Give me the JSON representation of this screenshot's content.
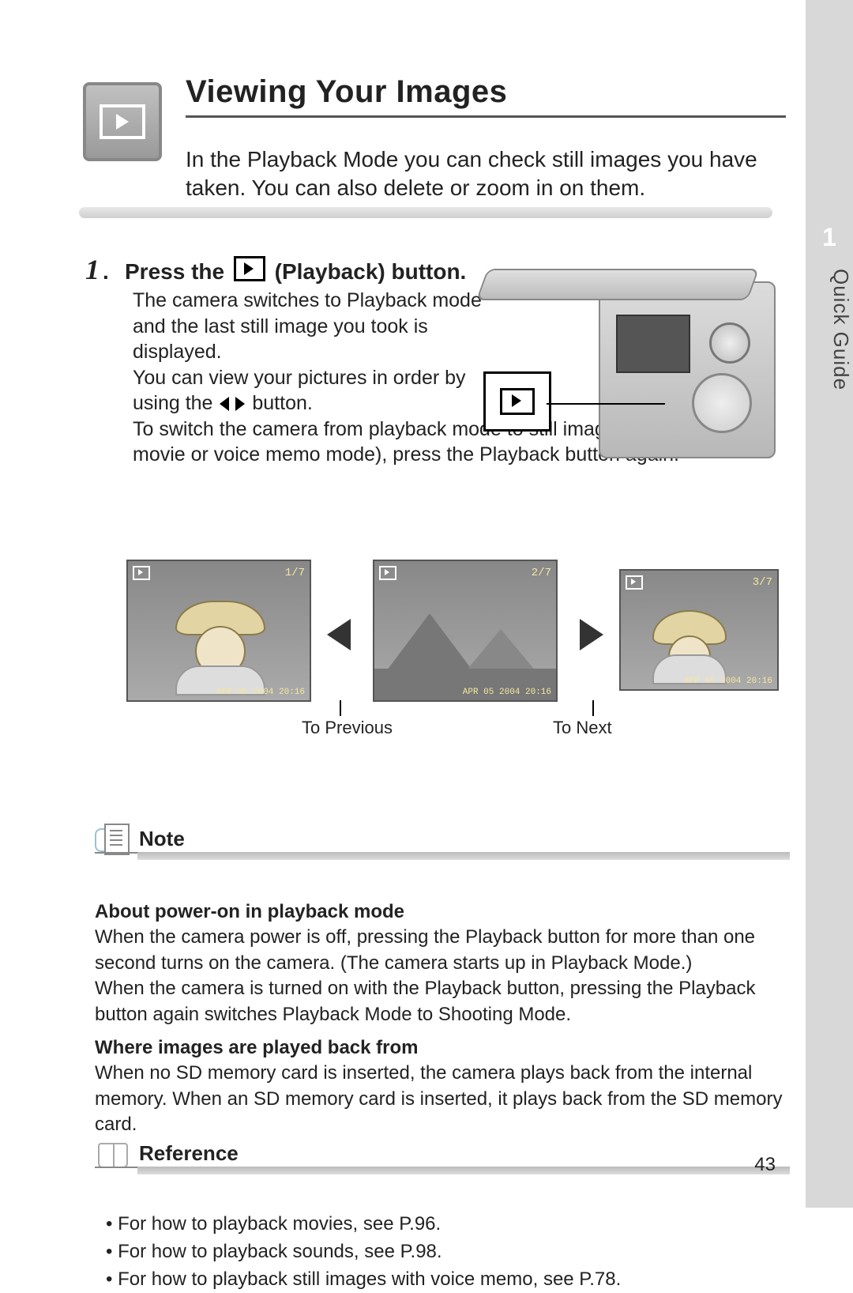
{
  "side": {
    "chapter": "1",
    "label": "Quick Guide"
  },
  "header": {
    "title": "Viewing Your Images",
    "intro": "In the Playback Mode you can check still images you have taken. You can also delete or zoom in on them."
  },
  "step": {
    "number": "1",
    "dot": ".",
    "title_prefix": "Press the ",
    "title_suffix": " (Playback) button.",
    "body_p1": "The camera switches to Playback mode and the last still image you took is displayed.",
    "body_p2a": "You can view your pictures in order by using the ",
    "body_p2b": " button.",
    "body_p3": "To switch the camera from playback mode to still image mode (or movie or voice memo mode), press the Playback button again."
  },
  "thumbs": {
    "counter1": "1/7",
    "counter2": "2/7",
    "counter3": "3/7",
    "date": "APR 05 2004 20:16",
    "prev_label": "To Previous",
    "next_label": "To Next"
  },
  "note": {
    "title": "Note",
    "h1": "About power-on in playback mode",
    "p1": "When the camera power is off, pressing the Playback button for more than one second turns on the camera. (The camera starts up in Playback Mode.)",
    "p2": "When the camera is turned on with the Playback button, pressing the Playback button again switches Playback Mode to Shooting Mode.",
    "h2": "Where images are played back from",
    "p3": "When no SD memory card is inserted, the camera plays back from the internal memory. When an SD memory card is inserted, it plays back from the SD memory card."
  },
  "reference": {
    "title": "Reference",
    "items": [
      "For how to playback movies, see P.96.",
      "For how to playback sounds, see P.98.",
      "For how to playback still images with voice memo, see P.78."
    ]
  },
  "page_number": "43"
}
